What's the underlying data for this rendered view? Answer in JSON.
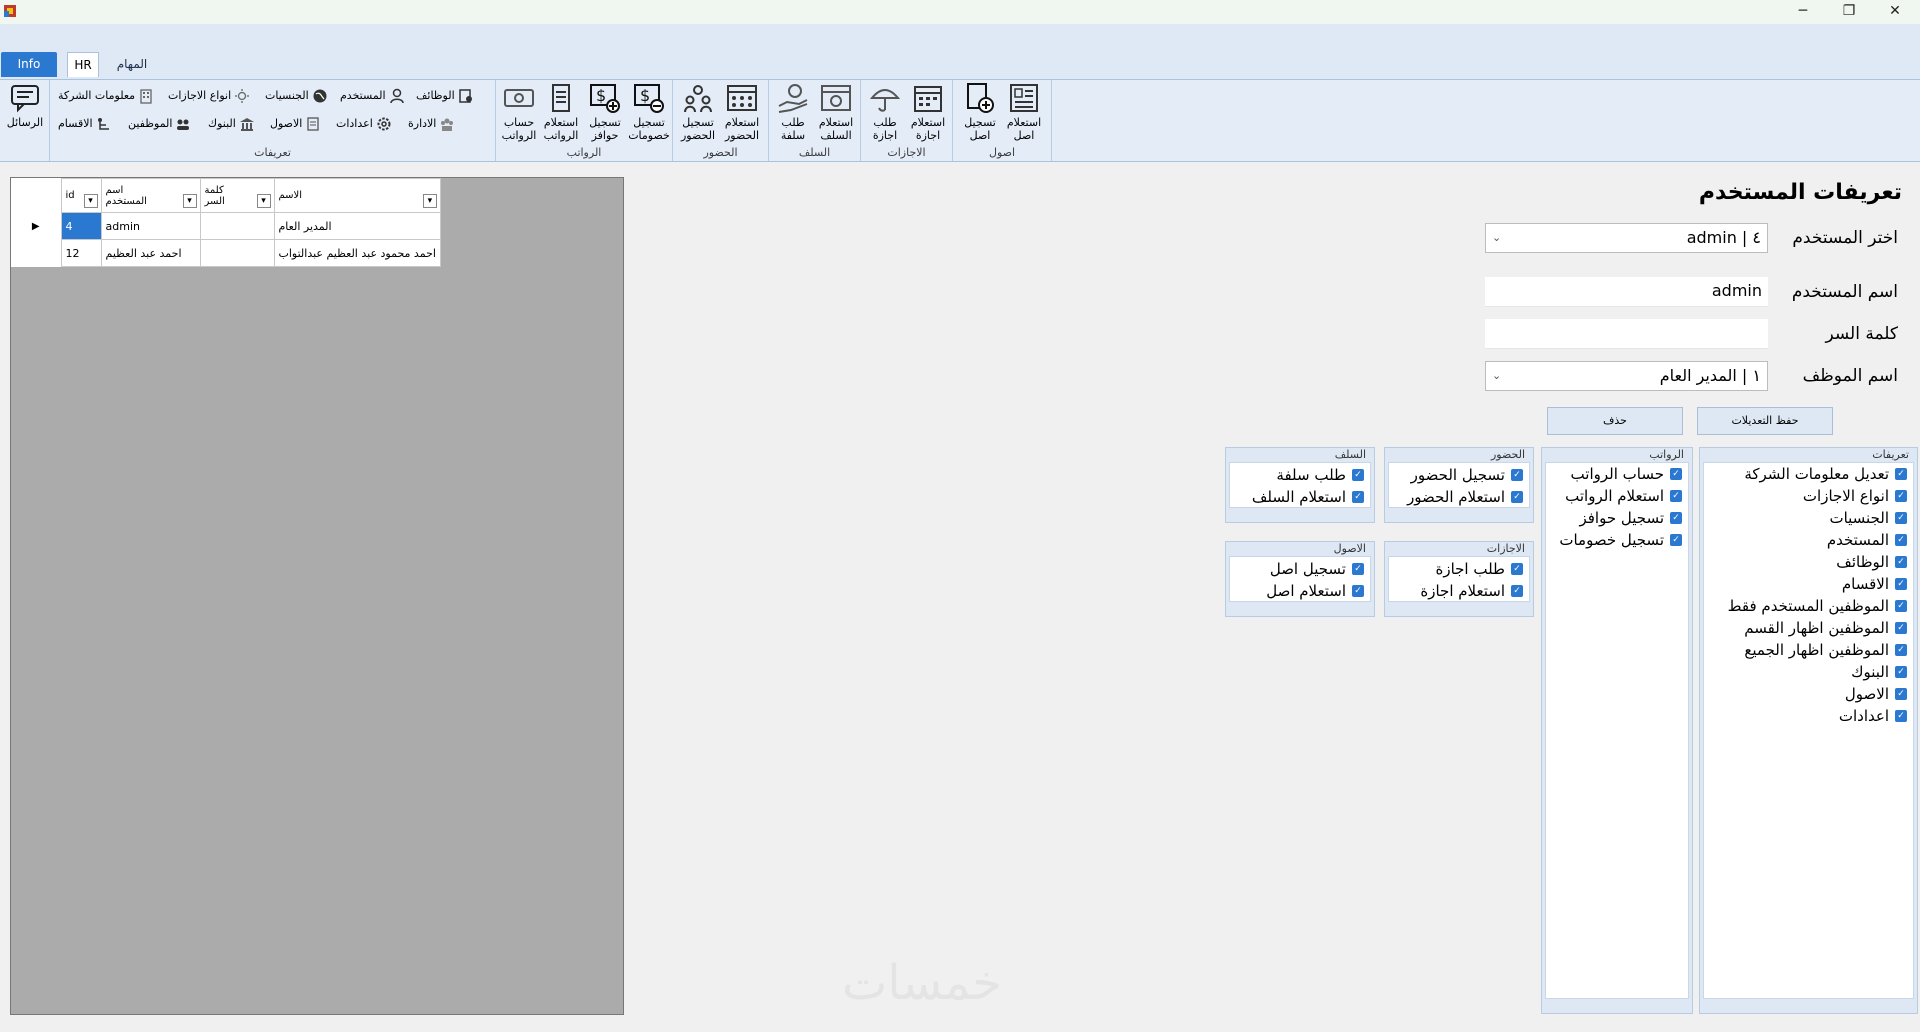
{
  "window": {
    "minimize": "─",
    "restore": "❐",
    "close": "✕"
  },
  "tabs": [
    "Info",
    "HR",
    "المهام"
  ],
  "ribbon": {
    "messages_label": "الرسائل",
    "groups": {
      "definitions": {
        "label": "تعريفات",
        "row1": [
          "الوظائف",
          "المستخدم",
          "الجنسيات",
          "انواع الاجازات",
          "معلومات الشركة"
        ],
        "row2": [
          "الادارة",
          "اعدادات",
          "الاصول",
          "البنوك",
          "الموظفين",
          "الاقسام"
        ]
      },
      "salaries": {
        "label": "الرواتب",
        "buttons": [
          "حساب\nالرواتب",
          "استعلام\nالرواتب",
          "تسجيل\nحوافز",
          "تسجيل\nخصومات"
        ]
      },
      "attendance": {
        "label": "الحضور",
        "buttons": [
          "تسجيل\nالحضور",
          "استعلام\nالحضور"
        ]
      },
      "advances": {
        "label": "السلف",
        "buttons": [
          "طلب\nسلفة",
          "استعلام\nالسلف"
        ]
      },
      "vacations": {
        "label": "الاجازات",
        "buttons": [
          "طلب\nاجازة",
          "استعلام\nاجازة"
        ]
      },
      "assets": {
        "label": "اصول",
        "buttons": [
          "تسجيل\nاصل",
          "استعلام\nاصل"
        ]
      }
    }
  },
  "grid": {
    "columns": [
      "id",
      "اسم\nالمستخدم",
      "كلمة\nالسر",
      "الاسم"
    ],
    "rows": [
      {
        "id": "4",
        "username": "admin",
        "password": "",
        "name": "المدير العام"
      },
      {
        "id": "12",
        "username": "احمد عبد العظيم",
        "password": "",
        "name": "احمد محمود عبد العظيم عبدالتواب"
      }
    ]
  },
  "form": {
    "title": "تعريفات المستخدم",
    "select_user_label": "اختر المستخدم",
    "select_user_value": "٤ | admin",
    "username_label": "اسم المستخدم",
    "username_value": "admin",
    "password_label": "كلمة السر",
    "password_value": "",
    "employee_label": "اسم الموظف",
    "employee_value": "١ | المدير العام",
    "save_label": "حفظ التعديلات",
    "delete_label": "حذف"
  },
  "permissions": {
    "definitions": {
      "title": "تعريفات",
      "items": [
        "تعديل معلومات الشركة",
        "انواع الاجازات",
        "الجنسيات",
        "المستخدم",
        "الوظائف",
        "الاقسام",
        "الموظفين المستخدم فقط",
        "الموظفين اظهار القسم",
        "الموظفين اظهار الجميع",
        "البنوك",
        "الاصول",
        "اعدادات"
      ]
    },
    "salaries": {
      "title": "الرواتب",
      "items": [
        "حساب الرواتب",
        "استعلام الرواتب",
        "تسجيل حوافز",
        "تسجيل خصومات"
      ]
    },
    "attendance": {
      "title": "الحضور",
      "items": [
        "تسجيل الحضور",
        "استعلام الحضور"
      ]
    },
    "advances": {
      "title": "السلف",
      "items": [
        "طلب سلفة",
        "استعلام السلف"
      ]
    },
    "vacations": {
      "title": "الاجازات",
      "items": [
        "طلب اجازة",
        "استعلام اجازة"
      ]
    },
    "assets": {
      "title": "الاصول",
      "items": [
        "تسجيل اصل",
        "استعلام اصل"
      ]
    }
  },
  "watermark": "خمسات"
}
